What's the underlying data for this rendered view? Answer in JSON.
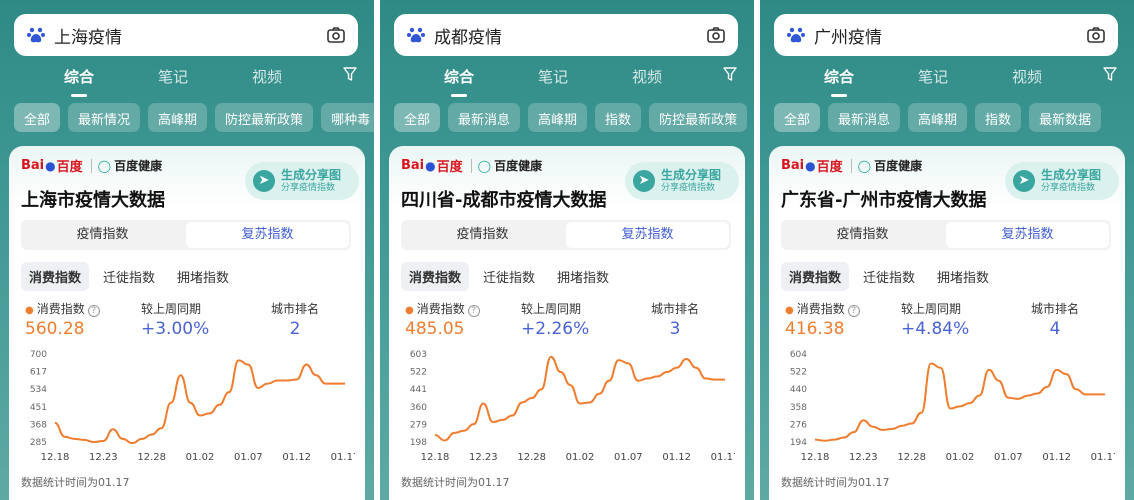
{
  "panels": [
    {
      "search_query": "上海疫情",
      "tabs": [
        "综合",
        "笔记",
        "视频"
      ],
      "chips": [
        "全部",
        "最新情况",
        "高峰期",
        "防控最新政策",
        "哪种毒"
      ],
      "brand": {
        "baidu": "Bai",
        "du": "百度",
        "health": "百度健康"
      },
      "share": {
        "title": "生成分享图",
        "subtitle": "分享疫情指数"
      },
      "card_title": "上海市疫情大数据",
      "segments": [
        "疫情指数",
        "复苏指数"
      ],
      "sub_tabs": [
        "消费指数",
        "迁徙指数",
        "拥堵指数"
      ],
      "stats": {
        "index_label": "消费指数",
        "index_value": "560.28",
        "wow_label": "较上周同期",
        "wow_value": "+3.00%",
        "rank_label": "城市排名",
        "rank_value": "2"
      },
      "y_ticks": [
        "700",
        "617",
        "534",
        "451",
        "368",
        "285"
      ],
      "x_ticks": [
        "12.18",
        "12.23",
        "12.28",
        "01.02",
        "01.07",
        "01.12",
        "01.17"
      ],
      "footnote": "数据统计时间为01.17"
    },
    {
      "search_query": "成都疫情",
      "tabs": [
        "综合",
        "笔记",
        "视频"
      ],
      "chips": [
        "全部",
        "最新消息",
        "高峰期",
        "指数",
        "防控最新政策"
      ],
      "brand": {
        "baidu": "Bai",
        "du": "百度",
        "health": "百度健康"
      },
      "share": {
        "title": "生成分享图",
        "subtitle": "分享疫情指数"
      },
      "card_title": "四川省-成都市疫情大数据",
      "segments": [
        "疫情指数",
        "复苏指数"
      ],
      "sub_tabs": [
        "消费指数",
        "迁徙指数",
        "拥堵指数"
      ],
      "stats": {
        "index_label": "消费指数",
        "index_value": "485.05",
        "wow_label": "较上周同期",
        "wow_value": "+2.26%",
        "rank_label": "城市排名",
        "rank_value": "3"
      },
      "y_ticks": [
        "603",
        "522",
        "441",
        "360",
        "279",
        "198"
      ],
      "x_ticks": [
        "12.18",
        "12.23",
        "12.28",
        "01.02",
        "01.07",
        "01.12",
        "01.17"
      ],
      "footnote": "数据统计时间为01.17"
    },
    {
      "search_query": "广州疫情",
      "tabs": [
        "综合",
        "笔记",
        "视频"
      ],
      "chips": [
        "全部",
        "最新消息",
        "高峰期",
        "指数",
        "最新数据"
      ],
      "brand": {
        "baidu": "Bai",
        "du": "百度",
        "health": "百度健康"
      },
      "share": {
        "title": "生成分享图",
        "subtitle": "分享疫情指数"
      },
      "card_title": "广东省-广州市疫情大数据",
      "segments": [
        "疫情指数",
        "复苏指数"
      ],
      "sub_tabs": [
        "消费指数",
        "迁徙指数",
        "拥堵指数"
      ],
      "stats": {
        "index_label": "消费指数",
        "index_value": "416.38",
        "wow_label": "较上周同期",
        "wow_value": "+4.84%",
        "rank_label": "城市排名",
        "rank_value": "4"
      },
      "y_ticks": [
        "604",
        "522",
        "440",
        "358",
        "276",
        "194"
      ],
      "x_ticks": [
        "12.18",
        "12.23",
        "12.28",
        "01.02",
        "01.07",
        "01.12",
        "01.17"
      ],
      "footnote": "数据统计时间为01.17"
    }
  ],
  "chart_data": [
    {
      "type": "line",
      "x": [
        "12.18",
        "12.19",
        "12.20",
        "12.21",
        "12.22",
        "12.23",
        "12.24",
        "12.25",
        "12.26",
        "12.27",
        "12.28",
        "12.29",
        "12.30",
        "12.31",
        "01.01",
        "01.02",
        "01.03",
        "01.04",
        "01.05",
        "01.06",
        "01.07",
        "01.08",
        "01.09",
        "01.10",
        "01.11",
        "01.12",
        "01.13",
        "01.14",
        "01.15",
        "01.16",
        "01.17"
      ],
      "series": [
        {
          "values": [
            375,
            310,
            300,
            295,
            285,
            290,
            345,
            300,
            280,
            300,
            320,
            350,
            470,
            600,
            470,
            410,
            420,
            460,
            520,
            670,
            650,
            540,
            560,
            575,
            575,
            580,
            650,
            600,
            560,
            560,
            560
          ]
        }
      ],
      "ylim": [
        285,
        700
      ],
      "color": "#ef7d2f"
    },
    {
      "type": "line",
      "x": [
        "12.18",
        "12.19",
        "12.20",
        "12.21",
        "12.22",
        "12.23",
        "12.24",
        "12.25",
        "12.26",
        "12.27",
        "12.28",
        "12.29",
        "12.30",
        "12.31",
        "01.01",
        "01.02",
        "01.03",
        "01.04",
        "01.05",
        "01.06",
        "01.07",
        "01.08",
        "01.09",
        "01.10",
        "01.11",
        "01.12",
        "01.13",
        "01.14",
        "01.15",
        "01.16",
        "01.17"
      ],
      "series": [
        {
          "values": [
            230,
            205,
            240,
            250,
            280,
            375,
            290,
            300,
            320,
            380,
            400,
            440,
            590,
            520,
            460,
            375,
            380,
            420,
            480,
            575,
            560,
            480,
            490,
            500,
            520,
            540,
            580,
            540,
            490,
            485,
            485
          ]
        }
      ],
      "ylim": [
        198,
        603
      ],
      "color": "#ef7d2f"
    },
    {
      "type": "line",
      "x": [
        "12.18",
        "12.19",
        "12.20",
        "12.21",
        "12.22",
        "12.23",
        "12.24",
        "12.25",
        "12.26",
        "12.27",
        "12.28",
        "12.29",
        "12.30",
        "12.31",
        "01.01",
        "01.02",
        "01.03",
        "01.04",
        "01.05",
        "01.06",
        "01.07",
        "01.08",
        "01.09",
        "01.10",
        "01.11",
        "01.12",
        "01.13",
        "01.14",
        "01.15",
        "01.16",
        "01.17"
      ],
      "series": [
        {
          "values": [
            205,
            200,
            205,
            215,
            240,
            295,
            265,
            250,
            255,
            270,
            280,
            330,
            560,
            540,
            350,
            360,
            375,
            410,
            530,
            480,
            400,
            395,
            410,
            420,
            450,
            530,
            510,
            440,
            416,
            416,
            416
          ]
        }
      ],
      "ylim": [
        194,
        604
      ],
      "color": "#ef7d2f"
    }
  ]
}
